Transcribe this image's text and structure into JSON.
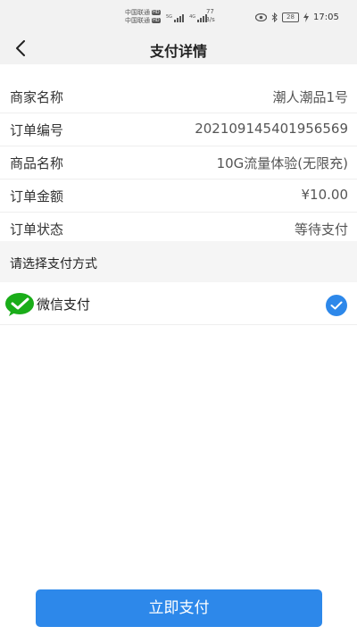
{
  "status_bar": {
    "carrier_1": "中国联通",
    "carrier_2": "中国联通",
    "hd_badge": "HD",
    "net_speed_value": "77",
    "net_speed_unit": "B/s",
    "battery": "28",
    "time": "17:05",
    "icons": [
      "eye-icon",
      "bluetooth-icon",
      "charging-icon"
    ]
  },
  "header": {
    "title": "支付详情",
    "back_icon": "chevron-left-icon"
  },
  "order_info": [
    {
      "label": "商家名称",
      "value": "潮人潮品1号"
    },
    {
      "label": "订单编号",
      "value": "202109145401956569"
    },
    {
      "label": "商品名称",
      "value": "10G流量体验(无限充)"
    },
    {
      "label": "订单金额",
      "value": "¥10.00"
    },
    {
      "label": "订单状态",
      "value": "等待支付"
    }
  ],
  "payment_section": {
    "title": "请选择支付方式",
    "methods": [
      {
        "label": "微信支付",
        "icon": "wechat-icon",
        "selected": true
      }
    ]
  },
  "actions": {
    "pay_now": "立即支付"
  },
  "colors": {
    "accent": "#2d88ea",
    "wechat_green": "#1aad19",
    "header_bg": "#f2f2f2"
  }
}
